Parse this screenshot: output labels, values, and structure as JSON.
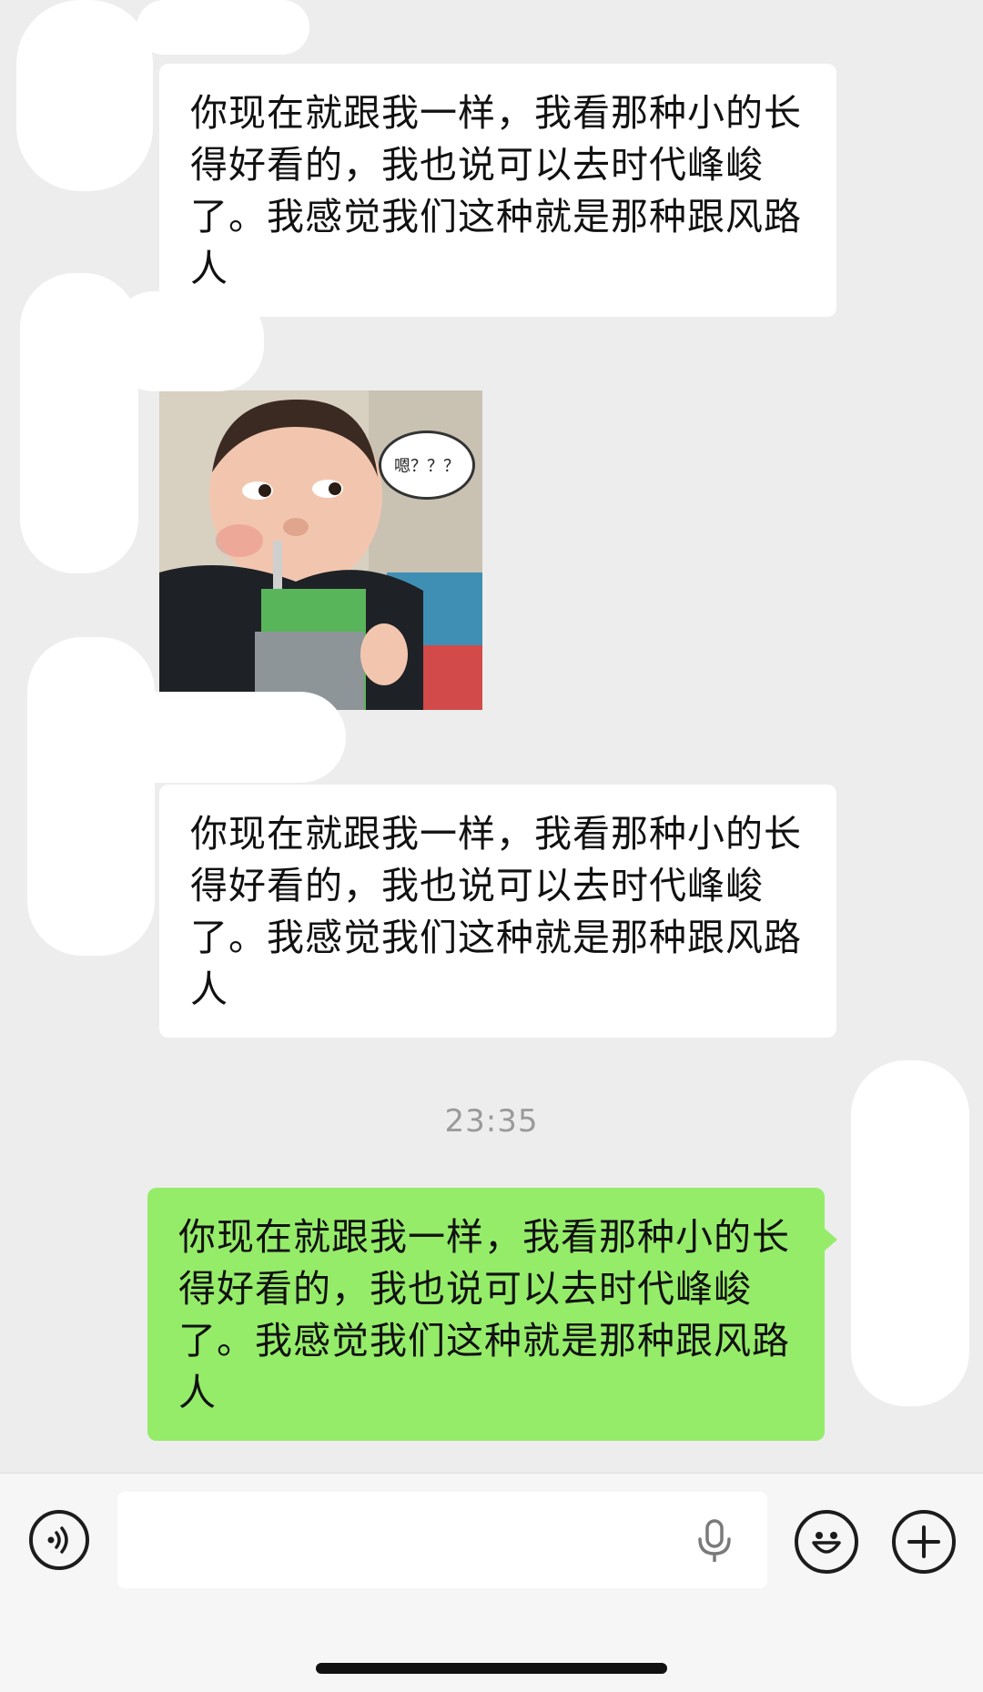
{
  "messages": [
    {
      "id": "m1",
      "side": "incoming",
      "text": "你现在就跟我一样，我看那种小的长得好看的，我也说可以去时代峰峻了。我感觉我们这种就是那种跟风路人"
    },
    {
      "id": "m2",
      "side": "incoming",
      "type": "sticker",
      "caption": "嗯？？？"
    },
    {
      "id": "m3",
      "side": "incoming",
      "text": "你现在就跟我一样，我看那种小的长得好看的，我也说可以去时代峰峻了。我感觉我们这种就是那种跟风路人"
    },
    {
      "id": "m4",
      "side": "outgoing",
      "text": "你现在就跟我一样，我看那种小的长得好看的，我也说可以去时代峰峻了。我感觉我们这种就是那种跟风路人"
    }
  ],
  "timestamp": "23:35",
  "input_bar": {
    "voice_icon": "voice-wave-icon",
    "mic_icon": "microphone-icon",
    "emoji_icon": "smiley-icon",
    "plus_icon": "plus-circle-icon",
    "text_value": ""
  },
  "colors": {
    "background": "#ededed",
    "incoming_bubble": "#ffffff",
    "outgoing_bubble": "#95ec69",
    "timestamp": "#9a9a9a"
  }
}
